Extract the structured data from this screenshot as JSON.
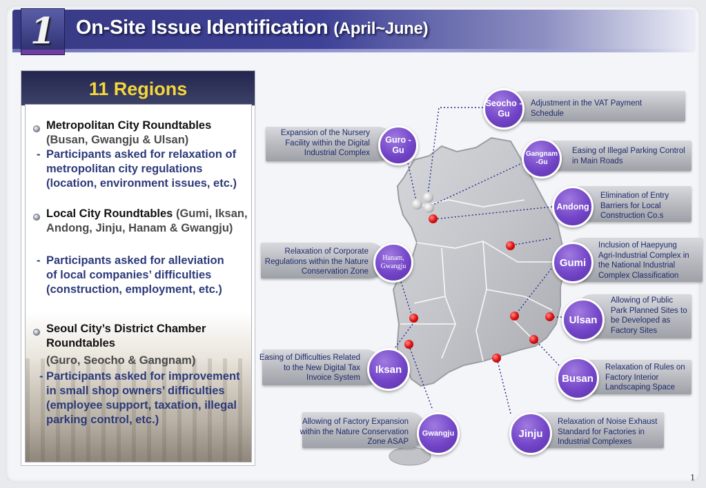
{
  "header": {
    "number": "1",
    "title_main": "On-Site Issue Identification",
    "title_sub": "(April~June)"
  },
  "left_panel": {
    "heading": "11 Regions",
    "sections": [
      {
        "title": "Metropolitan City Roundtables",
        "subtitle": "(Busan, Gwangju & Ulsan)",
        "detail": "Participants asked for relaxation of metropolitan city regulations (location, environment issues, etc.)"
      },
      {
        "title": "Local City Roundtables",
        "subtitle": "(Gumi, Iksan, Andong, Jinju, Hanam & Gwangju)",
        "detail": "Participants asked for alleviation of local companies’ difficulties (construction, employment, etc.)"
      },
      {
        "title": "Seoul City’s District Chamber Roundtables",
        "subtitle": "(Guro, Seocho & Gangnam)",
        "detail": "Participants asked for improvement in small shop owners’ difficulties (employee support, taxation, illegal parking control, etc.)"
      }
    ]
  },
  "callouts": {
    "seocho": {
      "label": "Seocho -Gu",
      "text": "Adjustment in the VAT Payment Schedule"
    },
    "guro": {
      "label": "Guro -Gu",
      "text": "Expansion of the Nursery Facility within the Digital Industrial Complex"
    },
    "gangnam": {
      "label": "Gangnam -Gu",
      "text": "Easing of Illegal Parking Control in Main Roads"
    },
    "andong": {
      "label": "Andong",
      "text": "Elimination of Entry Barriers for Local Construction Co.s"
    },
    "hanam": {
      "label": "Hanam, Gwangju",
      "text": "Relaxation of Corporate Regulations within the Nature Conservation Zone"
    },
    "gumi": {
      "label": "Gumi",
      "text": "Inclusion of Haepyung Agri-Industrial Complex in the National Industrial Complex Classification"
    },
    "ulsan": {
      "label": "Ulsan",
      "text": "Allowing of Public Park Planned Sites to be Developed as Factory Sites"
    },
    "iksan": {
      "label": "Iksan",
      "text": "Easing of Difficulties Related to the New Digital Tax Invoice System"
    },
    "busan": {
      "label": "Busan",
      "text": "Relaxation of Rules on Factory Interior Landscaping Space"
    },
    "gwangju": {
      "label": "Gwangju",
      "text": "Allowing of Factory Expansion within the Nature Conservation Zone ASAP"
    },
    "jinju": {
      "label": "Jinju",
      "text": "Relaxation of Noise Exhaust Standard for Factories in Industrial Complexes"
    }
  },
  "colors": {
    "header": "#3e4196",
    "accent_purple": "#7345c8",
    "regions_heading": "#f6d73a",
    "detail_text": "#2c3a7a"
  },
  "page_number": "1"
}
